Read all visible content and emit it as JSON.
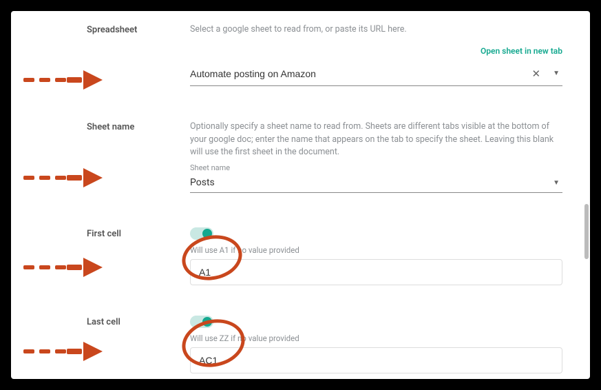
{
  "spreadsheet": {
    "label": "Spreadsheet",
    "helper": "Select a google sheet to read from, or paste its URL here.",
    "link": "Open sheet in new tab",
    "value": "Automate posting on Amazon"
  },
  "sheetname": {
    "label": "Sheet name",
    "helper": "Optionally specify a sheet name to read from. Sheets are different tabs visible at the bottom of your google doc; enter the name that appears on the tab to specify the sheet. Leaving this blank will use the first sheet in the document.",
    "mini_label": "Sheet name",
    "value": "Posts"
  },
  "firstcell": {
    "label": "First cell",
    "helper": "Will use A1 if no value provided",
    "value": "A1"
  },
  "lastcell": {
    "label": "Last cell",
    "helper": "Will use ZZ if no value provided",
    "value": "AC1"
  }
}
